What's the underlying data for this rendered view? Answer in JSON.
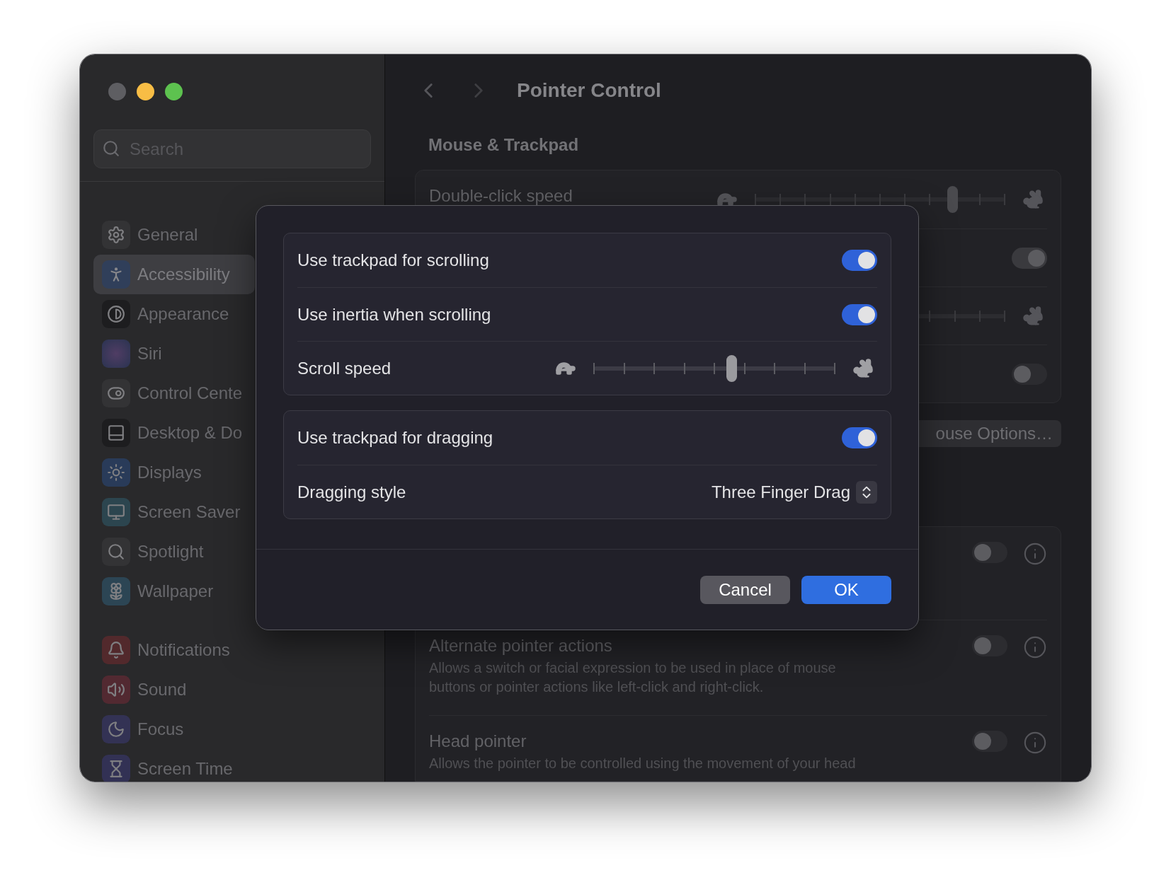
{
  "sidebar": {
    "search": {
      "placeholder": "Search"
    },
    "sections": [
      {
        "items": [
          {
            "label": "General",
            "selected": false
          },
          {
            "label": "Accessibility",
            "selected": true
          },
          {
            "label": "Appearance",
            "selected": false
          },
          {
            "label": "Siri",
            "selected": false
          },
          {
            "label": "Control Cente",
            "selected": false
          },
          {
            "label": "Desktop & Do",
            "selected": false
          },
          {
            "label": "Displays",
            "selected": false
          },
          {
            "label": "Screen Saver",
            "selected": false
          },
          {
            "label": "Spotlight",
            "selected": false
          },
          {
            "label": "Wallpaper",
            "selected": false
          }
        ]
      },
      {
        "items": [
          {
            "label": "Notifications",
            "selected": false
          },
          {
            "label": "Sound",
            "selected": false
          },
          {
            "label": "Focus",
            "selected": false
          },
          {
            "label": "Screen Time",
            "selected": false
          }
        ]
      }
    ]
  },
  "main": {
    "title": "Pointer Control",
    "section_title": "Mouse & Trackpad",
    "settings_rows": [
      {
        "kind": "slider",
        "label": "Double-click speed",
        "level": 0.79
      },
      {
        "kind": "toggle",
        "on": true
      },
      {
        "kind": "slider"
      },
      {
        "kind": "toggle",
        "on": false
      }
    ],
    "options_button": "ouse Options…",
    "accessory_rows": [
      {
        "on": false
      },
      {
        "label": "Alternate pointer actions",
        "description": "Allows a switch or facial expression to be used in place of mouse buttons or pointer actions like left-click and right-click.",
        "on": false
      },
      {
        "label": "Head pointer",
        "description": "Allows the pointer to be controlled using the movement of your head",
        "on": false
      }
    ]
  },
  "dialog": {
    "groups": [
      {
        "rows": [
          {
            "kind": "toggle",
            "label": "Use trackpad for scrolling",
            "on": true
          },
          {
            "kind": "toggle",
            "label": "Use inertia when scrolling",
            "on": true
          },
          {
            "kind": "slider",
            "label": "Scroll speed",
            "level": 0.57
          }
        ]
      },
      {
        "rows": [
          {
            "kind": "toggle",
            "label": "Use trackpad for dragging",
            "on": true
          },
          {
            "kind": "popup",
            "label": "Dragging style",
            "value": "Three Finger Drag"
          }
        ]
      }
    ],
    "buttons": [
      {
        "kind": "secondary",
        "label": "Cancel"
      },
      {
        "kind": "primary",
        "label": "OK"
      }
    ]
  }
}
